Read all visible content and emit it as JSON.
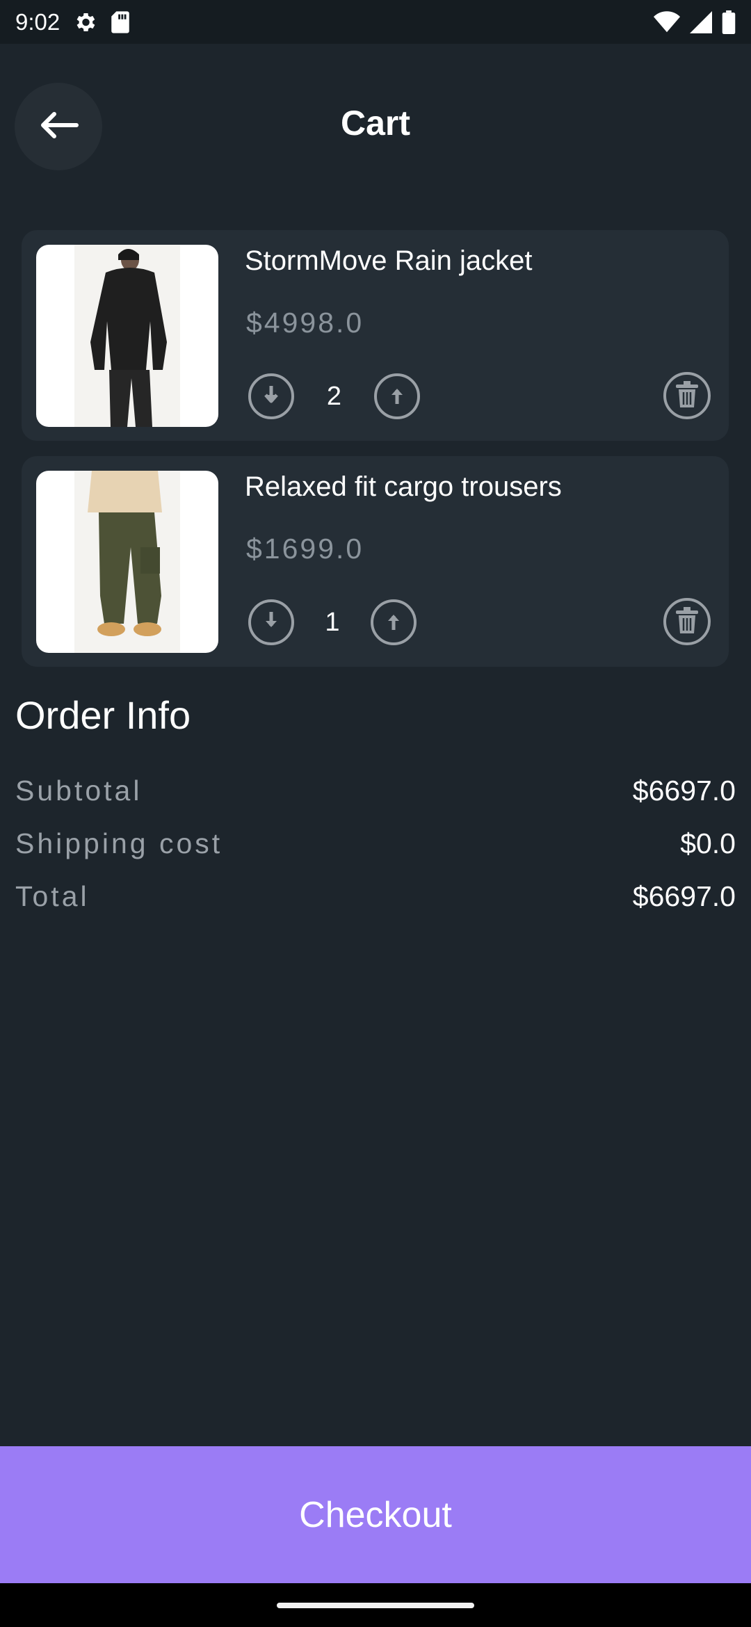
{
  "status_bar": {
    "time": "9:02",
    "icons": [
      "settings-gear-icon",
      "sd-card-icon",
      "wifi-icon",
      "signal-icon",
      "battery-icon"
    ]
  },
  "app_bar": {
    "title": "Cart",
    "back_icon": "arrow-left-icon"
  },
  "cart": {
    "items": [
      {
        "name": "StormMove Rain jacket",
        "price": "$4998.0",
        "quantity": "2",
        "image": "black-rain-jacket-photo"
      },
      {
        "name": "Relaxed fit cargo trousers",
        "price": "$1699.0",
        "quantity": "1",
        "image": "olive-cargo-trousers-photo"
      }
    ]
  },
  "order_info": {
    "title": "Order Info",
    "rows": [
      {
        "label": "Subtotal",
        "value": "$6697.0"
      },
      {
        "label": "Shipping cost",
        "value": "$0.0"
      },
      {
        "label": "Total",
        "value": "$6697.0"
      }
    ]
  },
  "checkout": {
    "label": "Checkout"
  },
  "colors": {
    "background": "#1d252c",
    "card": "#252e36",
    "accent": "#9b7cf5",
    "muted_text": "#9aa1a8"
  }
}
